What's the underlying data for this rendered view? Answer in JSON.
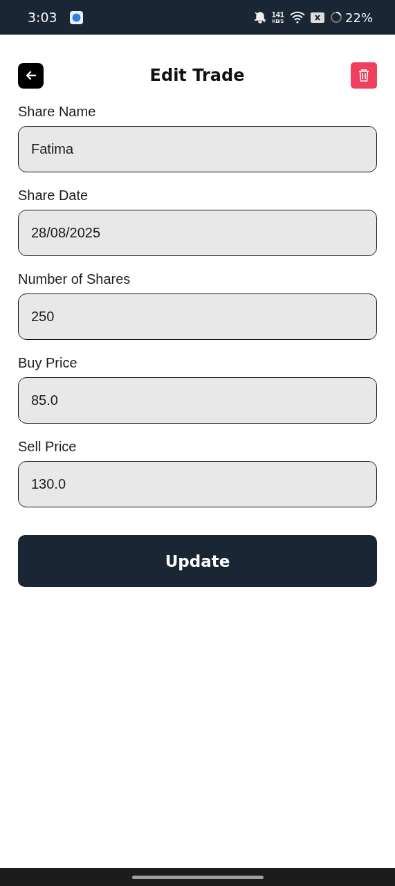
{
  "status_bar": {
    "time": "3:03",
    "speed_value": "141",
    "speed_unit": "KB/S",
    "battery": "22%"
  },
  "header": {
    "title": "Edit Trade"
  },
  "fields": [
    {
      "label": "Share Name",
      "value": "Fatima"
    },
    {
      "label": "Share Date",
      "value": "28/08/2025"
    },
    {
      "label": "Number of Shares",
      "value": "250"
    },
    {
      "label": "Buy Price",
      "value": "85.0"
    },
    {
      "label": "Sell Price",
      "value": "130.0"
    }
  ],
  "submit_button": "Update"
}
